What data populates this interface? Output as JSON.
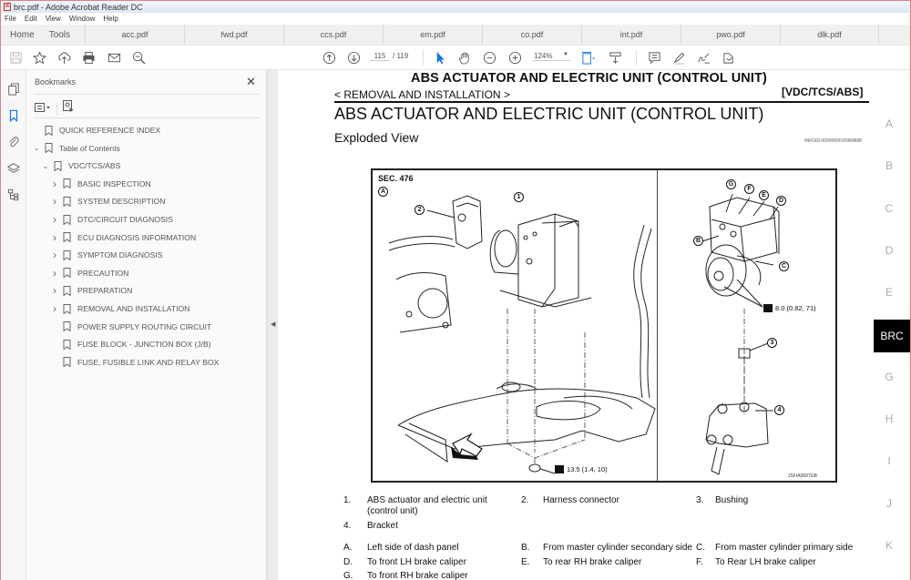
{
  "window": {
    "title": "brc.pdf - Adobe Acrobat Reader DC",
    "menu": [
      "File",
      "Edit",
      "View",
      "Window",
      "Help"
    ]
  },
  "tabs": {
    "home": "Home",
    "tools": "Tools",
    "documents": [
      "acc.pdf",
      "fwd.pdf",
      "ccs.pdf",
      "em.pdf",
      "co.pdf",
      "int.pdf",
      "pwo.pdf",
      "dlk.pdf"
    ]
  },
  "toolbar": {
    "icons": [
      "save-icon",
      "star-icon",
      "upload-icon",
      "print-icon",
      "email-icon",
      "search-zoom-icon",
      "prev-page-icon",
      "next-page-icon",
      "select-cursor-icon",
      "hand-icon",
      "zoom-out-icon",
      "zoom-in-icon",
      "fit-page-icon",
      "scroll-mode-icon",
      "comment-icon",
      "highlight-icon",
      "sign-icon",
      "share-icon"
    ],
    "current_page": "115",
    "total_pages": "/ 119",
    "zoom": "124%",
    "accent_color": "#1473e6"
  },
  "left_rail": {
    "icons": [
      "pages-icon",
      "bookmarks-icon",
      "attachments-icon",
      "layers-icon",
      "structure-icon"
    ]
  },
  "bookmarks": {
    "title": "Bookmarks",
    "items": [
      {
        "label": "QUICK REFERENCE INDEX",
        "level": 0,
        "expander": ""
      },
      {
        "label": "Table of Contents",
        "level": 0,
        "expander": "expanded"
      },
      {
        "label": "VDC/TCS/ABS",
        "level": 1,
        "expander": "expanded"
      },
      {
        "label": "BASIC INSPECTION",
        "level": 2,
        "expander": "collapsed"
      },
      {
        "label": "SYSTEM DESCRIPTION",
        "level": 2,
        "expander": "collapsed"
      },
      {
        "label": "DTC/CIRCUIT DIAGNOSIS",
        "level": 2,
        "expander": "collapsed"
      },
      {
        "label": "ECU DIAGNOSIS INFORMATION",
        "level": 2,
        "expander": "collapsed"
      },
      {
        "label": "SYMPTOM DIAGNOSIS",
        "level": 2,
        "expander": "collapsed"
      },
      {
        "label": "PRECAUTION",
        "level": 2,
        "expander": "collapsed"
      },
      {
        "label": "PREPARATION",
        "level": 2,
        "expander": "collapsed"
      },
      {
        "label": "REMOVAL AND INSTALLATION",
        "level": 2,
        "expander": "collapsed"
      },
      {
        "label": "POWER SUPPLY ROUTING CIRCUIT",
        "level": 2,
        "expander": ""
      },
      {
        "label": "FUSE BLOCK - JUNCTION BOX (J/B)",
        "level": 2,
        "expander": ""
      },
      {
        "label": "FUSE, FUSIBLE LINK AND RELAY BOX",
        "level": 2,
        "expander": ""
      }
    ]
  },
  "document": {
    "running_header": "ABS ACTUATOR AND ELECTRIC UNIT (CONTROL UNIT)",
    "section_path": "< REMOVAL AND INSTALLATION >",
    "section_code": "[VDC/TCS/ABS]",
    "title": "ABS ACTUATOR AND ELECTRIC UNIT (CONTROL UNIT)",
    "subtitle": "Exploded View",
    "info_id": "INFOID:0000000010989898",
    "figure": {
      "section": "SEC. 476",
      "view_marker": "A",
      "callouts_numbers": [
        "1",
        "2",
        "3",
        "4"
      ],
      "callouts_letters": [
        "B",
        "C",
        "D",
        "E",
        "F",
        "G"
      ],
      "torque_1": "13.5 (1.4, 10)",
      "torque_2": "8.0 (0.82, 71)",
      "figure_id": "JSFIA0007GB"
    },
    "legend_numbers": [
      {
        "num": "1.",
        "text": "ABS actuator and electric unit (control unit)"
      },
      {
        "num": "2.",
        "text": "Harness connector"
      },
      {
        "num": "3.",
        "text": "Bushing"
      },
      {
        "num": "4.",
        "text": "Bracket"
      }
    ],
    "legend_letters": [
      {
        "num": "A.",
        "text": "Left side of dash panel"
      },
      {
        "num": "B.",
        "text": "From master cylinder secondary side"
      },
      {
        "num": "C.",
        "text": "From master cylinder primary side"
      },
      {
        "num": "D.",
        "text": "To front LH brake caliper"
      },
      {
        "num": "E.",
        "text": "To rear RH brake caliper"
      },
      {
        "num": "F.",
        "text": "To Rear LH brake caliper"
      },
      {
        "num": "G.",
        "text": "To front RH brake caliper"
      }
    ],
    "side_index": [
      "A",
      "B",
      "C",
      "D",
      "E",
      "BRC",
      "G",
      "H",
      "I",
      "J",
      "K"
    ],
    "active_index": "BRC"
  }
}
